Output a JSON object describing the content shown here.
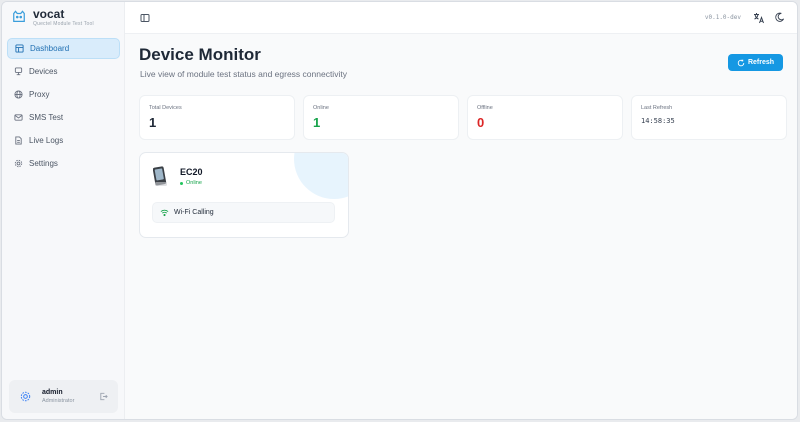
{
  "brand": {
    "name": "vocat",
    "subtitle": "Quectel Module Test Tool"
  },
  "sidebar": {
    "items": [
      {
        "label": "Dashboard",
        "icon": "dashboard-icon",
        "active": true
      },
      {
        "label": "Devices",
        "icon": "devices-icon"
      },
      {
        "label": "Proxy",
        "icon": "globe-icon"
      },
      {
        "label": "SMS Test",
        "icon": "mail-icon"
      },
      {
        "label": "Live Logs",
        "icon": "file-icon"
      },
      {
        "label": "Settings",
        "icon": "gear-icon"
      }
    ],
    "user": {
      "name": "admin",
      "role": "Administrator"
    }
  },
  "header": {
    "version": "v0.1.0-dev"
  },
  "main": {
    "title": "Device Monitor",
    "subtitle": "Live view of module test status and egress connectivity",
    "refresh_label": "Refresh",
    "stats": [
      {
        "label": "Total Devices",
        "value": "1"
      },
      {
        "label": "Online",
        "value": "1"
      },
      {
        "label": "Offline",
        "value": "0"
      },
      {
        "label": "Last Refresh",
        "value": "14:58:35"
      }
    ],
    "device": {
      "name": "EC20",
      "status": "Online",
      "feature": "Wi-Fi Calling"
    }
  },
  "colors": {
    "accent": "#1598e3",
    "online": "#16a34a",
    "offline": "#dc2626"
  }
}
